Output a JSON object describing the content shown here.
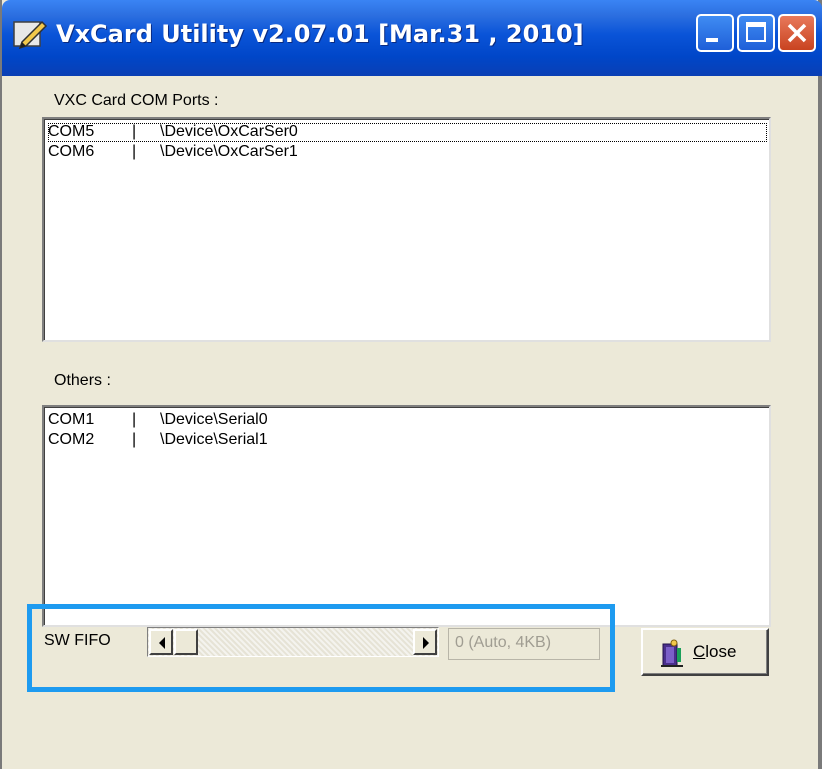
{
  "window": {
    "title": "VxCard Utility v2.07.01 [Mar.31 , 2010]",
    "title_icon": "pencil-app-icon",
    "controls": [
      "minimize-icon",
      "maximize-icon",
      "close-icon"
    ]
  },
  "vxc_ports": {
    "label": "VXC Card COM Ports :",
    "items": [
      {
        "port": "COM5",
        "sep": "|",
        "device": "\\Device\\OxCarSer0"
      },
      {
        "port": "COM6",
        "sep": "|",
        "device": "\\Device\\OxCarSer1"
      }
    ]
  },
  "others": {
    "label": "Others :",
    "items": [
      {
        "port": "COM1",
        "sep": "|",
        "device": "\\Device\\Serial0"
      },
      {
        "port": "COM2",
        "sep": "|",
        "device": "\\Device\\Serial1"
      }
    ]
  },
  "fifo": {
    "label": "SW FIFO",
    "value_text": "0 (Auto, 4KB)",
    "slider_position": 0
  },
  "close_button": {
    "mnemonic": "C",
    "rest": "lose",
    "icon": "door-exit-icon"
  },
  "colors": {
    "titlebar": "#0A54D8",
    "window_bg": "#ECE9D8",
    "highlight": "#1E9BF0",
    "close_control": "#C94320"
  }
}
